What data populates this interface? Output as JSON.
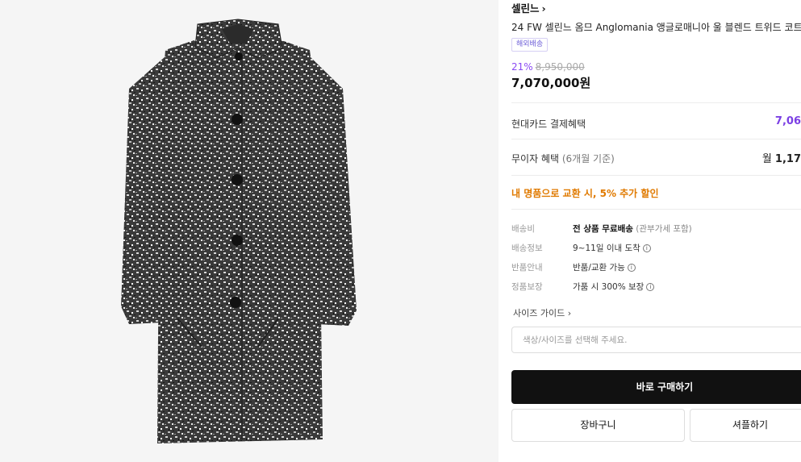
{
  "product": {
    "brand": "셀린느",
    "brand_chevron": "›",
    "title": "24 FW 셀린느 옴므 Anglomania 앵글로매니아 울 블렌드 트위드 코트",
    "badge": "해외배송",
    "discount_percent": "21%",
    "original_price": "8,950,000",
    "price": "7,070,000원"
  },
  "benefits": [
    {
      "label": "현대카드 결제혜택",
      "sub": "",
      "value": "7,06"
    },
    {
      "label": "무이자 혜택",
      "sub": "(6개월 기준)",
      "value_prefix": "월 ",
      "value": "1,17"
    }
  ],
  "promo": "내 명품으로 교환 시, 5% 추가 할인",
  "shipping": [
    {
      "key": "배송비",
      "value": "전 상품 무료배송",
      "note": "(관부가세 포함)"
    },
    {
      "key": "배송정보",
      "value": "9~11일 이내 도착",
      "note": ""
    },
    {
      "key": "반품안내",
      "value": "반품/교환 가능",
      "note": ""
    },
    {
      "key": "정품보장",
      "value": "가품 시 300% 보장",
      "note": ""
    }
  ],
  "info_icon": "i",
  "size_guide": "사이즈 가이드",
  "size_guide_chevron": "›",
  "option_placeholder": "색상/사이즈를 선택해 주세요.",
  "buttons": {
    "buy": "바로 구매하기",
    "cart": "장바구니",
    "showroom": "셔플하기"
  },
  "colors": {
    "accent_purple": "#7b3fe4",
    "promo_orange": "#e07a00",
    "buy_bg": "#111111"
  }
}
